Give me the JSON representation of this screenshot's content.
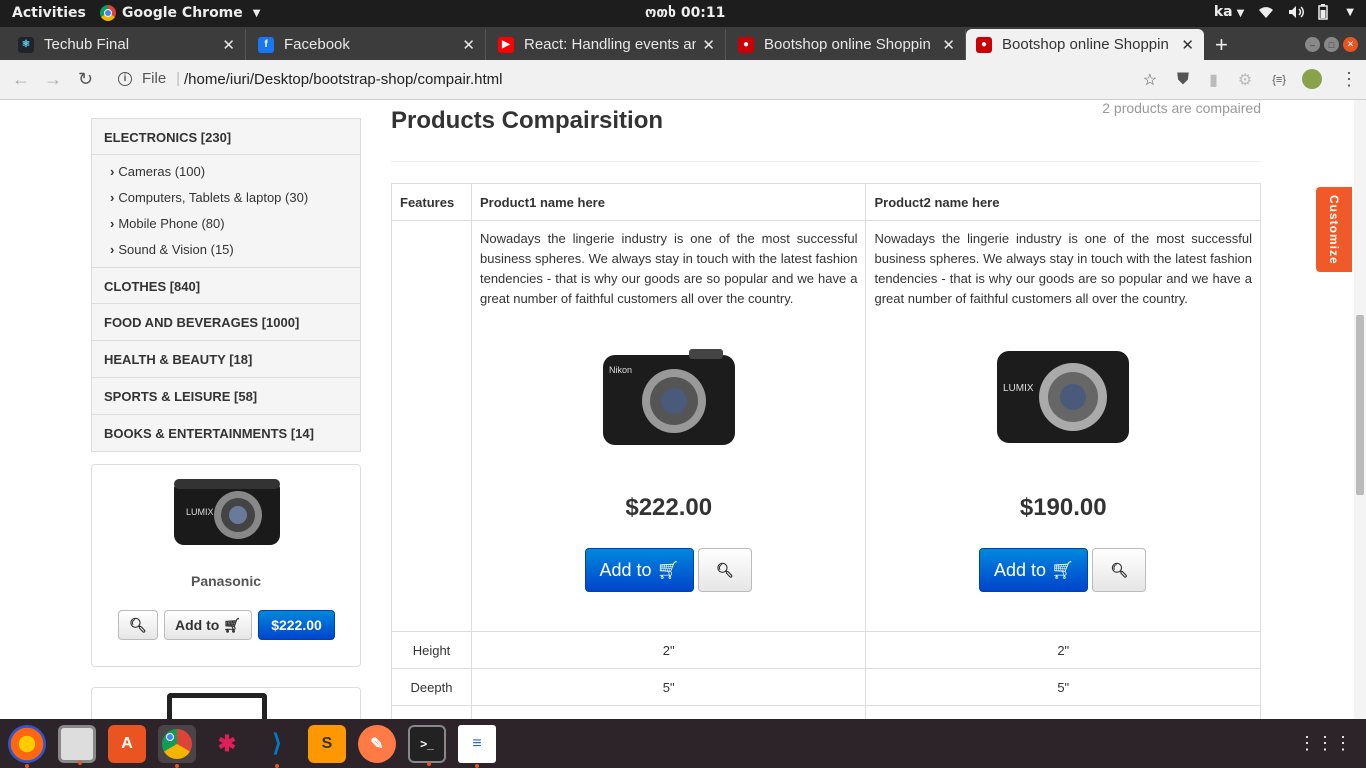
{
  "system_bar": {
    "activities": "Activities",
    "app_name": "Google Chrome",
    "clock": "ოთხ 00:11",
    "keyboard_layout": "ka"
  },
  "tabs": [
    {
      "title": "Techub Final",
      "favicon": "react-icon",
      "color": "#61dafb"
    },
    {
      "title": "Facebook",
      "favicon": "facebook-icon",
      "color": "#1877f2"
    },
    {
      "title": "React: Handling events an",
      "favicon": "youtube-icon",
      "color": "#ff0000"
    },
    {
      "title": "Bootshop online Shoppin",
      "favicon": "bootshop-icon",
      "color": "#c00"
    },
    {
      "title": "Bootshop online Shoppin",
      "favicon": "bootshop-icon",
      "color": "#c00",
      "active": true
    }
  ],
  "address_bar": {
    "security_label": "File",
    "url": "/home/iuri/Desktop/bootstrap-shop/compair.html"
  },
  "sidebar": {
    "categories_top": [
      {
        "label": "ELECTRONICS [230]"
      }
    ],
    "subcategories": [
      {
        "label": "Cameras (100)"
      },
      {
        "label": "Computers, Tablets & laptop (30)"
      },
      {
        "label": "Mobile Phone (80)"
      },
      {
        "label": "Sound & Vision (15)"
      }
    ],
    "categories_rest": [
      {
        "label": "CLOTHES [840]"
      },
      {
        "label": "FOOD AND BEVERAGES [1000]"
      },
      {
        "label": "HEALTH & BEAUTY [18]"
      },
      {
        "label": "SPORTS & LEISURE [58]"
      },
      {
        "label": "BOOKS & ENTERTAINMENTS [14]"
      }
    ],
    "featured": {
      "name": "Panasonic",
      "add_label": "Add to",
      "price": "$222.00"
    }
  },
  "main": {
    "title": "Products Compairsition",
    "count_text": "2 products are compaired",
    "table": {
      "features_header": "Features",
      "products": [
        {
          "name": "Product1 name here",
          "description": "Nowadays the lingerie industry is one of the most successful business spheres. We always stay in touch with the latest fashion tendencies - that is why our goods are so popular and we have a great number of faithful customers all over the country.",
          "price": "$222.00",
          "add_label": "Add to"
        },
        {
          "name": "Product2 name here",
          "description": "Nowadays the lingerie industry is one of the most successful business spheres. We always stay in touch with the latest fashion tendencies - that is why our goods are so popular and we have a great number of faithful customers all over the country.",
          "price": "$190.00",
          "add_label": "Add to"
        }
      ],
      "specs": [
        {
          "label": "Height",
          "values": [
            "2\"",
            "2\""
          ]
        },
        {
          "label": "Deepth",
          "values": [
            "5\"",
            "5\""
          ]
        }
      ]
    }
  },
  "customize_label": "Customize",
  "colors": {
    "primary_button": "#0044cc",
    "customize": "#f05a28",
    "ubuntu_accent": "#e95420"
  }
}
